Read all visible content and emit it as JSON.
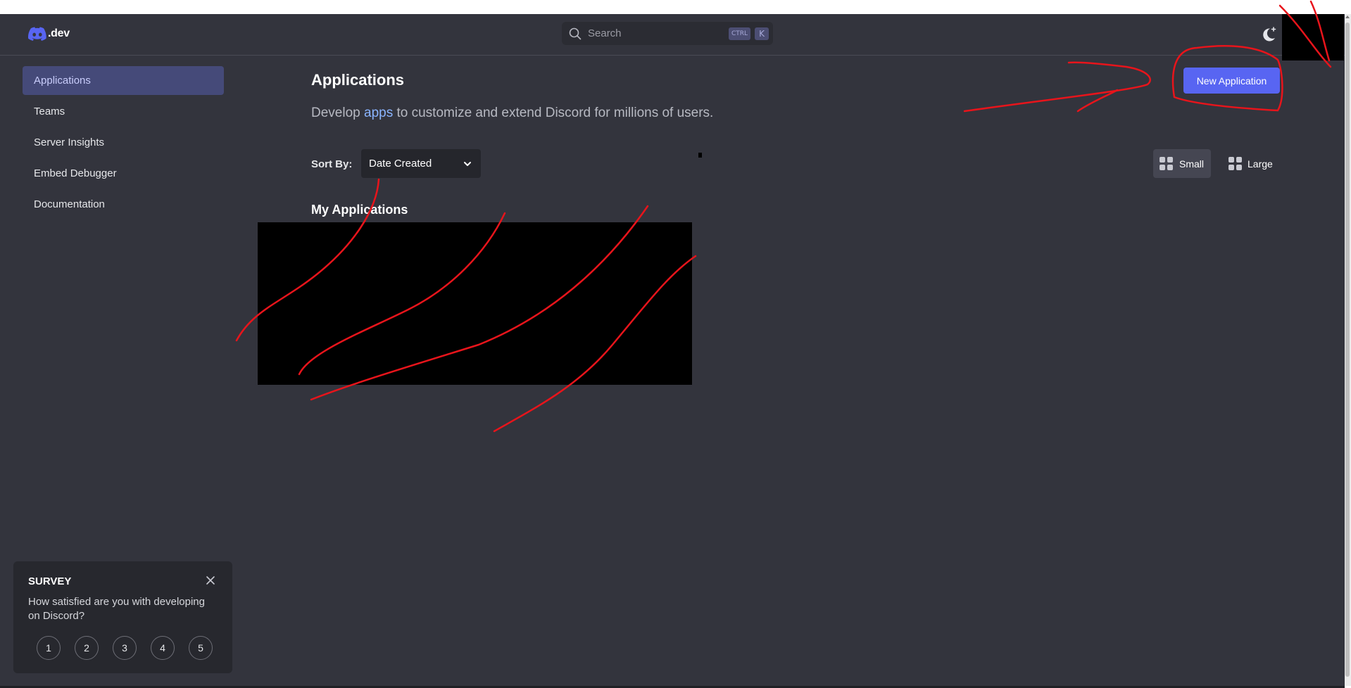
{
  "header": {
    "brand": ".dev",
    "search_placeholder": "Search",
    "shortcut_mod": "CTRL",
    "shortcut_key": "K"
  },
  "sidebar": {
    "items": [
      {
        "label": "Applications",
        "active": true
      },
      {
        "label": "Teams"
      },
      {
        "label": "Server Insights"
      },
      {
        "label": "Embed Debugger"
      },
      {
        "label": "Documentation"
      }
    ]
  },
  "main": {
    "title": "Applications",
    "subtitle_pre": "Develop ",
    "subtitle_link": "apps",
    "subtitle_post": " to customize and extend Discord for millions of users.",
    "new_app_label": "New Application",
    "sort_label": "Sort By:",
    "sort_value": "Date Created",
    "view_small": "Small",
    "view_large": "Large",
    "section_title": "My Applications"
  },
  "survey": {
    "title": "SURVEY",
    "question": "How satisfied are you with developing on Discord?",
    "options": [
      "1",
      "2",
      "3",
      "4",
      "5"
    ]
  },
  "colors": {
    "background": "#33343d",
    "accent": "#5865f2",
    "link": "#8ab4ff",
    "annotation": "#e8141b"
  }
}
